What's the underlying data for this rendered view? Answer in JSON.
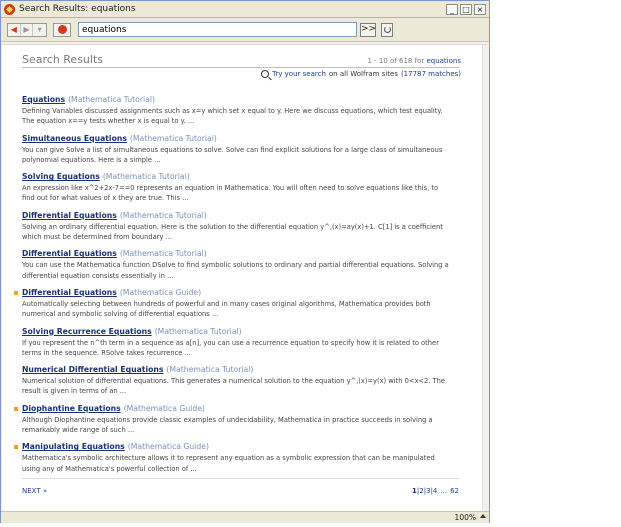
{
  "window": {
    "title": "Search Results: equations"
  },
  "toolbar": {
    "search_value": "equations",
    "go_label": ">>"
  },
  "header": {
    "title": "Search Results",
    "count_prefix": "1 - 10 of 618 for",
    "count_query": "equations",
    "try_prefix": "Try your search",
    "try_link": "Try your search",
    "try_middle": "on all Wolfram sites",
    "try_matches": "(17787 matches)"
  },
  "results": [
    {
      "title": "Equations",
      "source": "(Mathematica Tutorial)",
      "snippet": "Defining Variables discussed assignments such as x=y which set x equal to y. Here we discuss equations, which test equality. The equation x==y tests whether x is equal to y. ...",
      "marked": false
    },
    {
      "title": "Simultaneous Equations",
      "source": "(Mathematica Tutorial)",
      "snippet": "You can give Solve a list of simultaneous equations to solve. Solve can find explicit solutions for a large class of simultaneous polynomial equations. Here is a simple ...",
      "marked": false
    },
    {
      "title": "Solving Equations",
      "source": "(Mathematica Tutorial)",
      "snippet": "An expression like x^2+2x-7==0 represents an equation in Mathematica. You will often need to solve equations like this, to find out for what values of x they are true. This ...",
      "marked": false
    },
    {
      "title": "Differential Equations",
      "source": "(Mathematica Tutorial)",
      "snippet": "Solving an ordinary differential equation. Here is the solution to the differential equation y^,(x)=ay(x)+1. C[1] is a coefficient which must be determined from boundary ...",
      "marked": false
    },
    {
      "title": "Differential Equations",
      "source": "(Mathematica Tutorial)",
      "snippet": "You can use the Mathematica function DSolve to find symbolic solutions to ordinary and partial differential equations. Solving a differential equation consists essentially in ...",
      "marked": false
    },
    {
      "title": "Differential Equations",
      "source": "(Mathematica Guide)",
      "snippet": "Automatically selecting between hundreds of powerful and in many cases original algorithms, Mathematica provides both numerical and symbolic solving of differential equations ...",
      "marked": true
    },
    {
      "title": "Solving Recurrence Equations",
      "source": "(Mathematica Tutorial)",
      "snippet": "If you represent the n^th term in a sequence as a[n], you can use a recurrence equation to specify how it is related to other terms in the sequence. RSolve takes recurrence ...",
      "marked": false
    },
    {
      "title": "Numerical Differential Equations",
      "source": "(Mathematica Tutorial)",
      "snippet": "Numerical solution of differential equations. This generates a numerical solution to the equation y^,(x)=y(x) with 0<x<2. The result is given in terms of an ...",
      "marked": false
    },
    {
      "title": "Diophantine Equations",
      "source": "(Mathematica Guide)",
      "snippet": "Although Diophantine equations provide classic examples of undecidability, Mathematica in practice succeeds in solving a remarkably wide range of such ...",
      "marked": true
    },
    {
      "title": "Manipulating Equations",
      "source": "(Mathematica Guide)",
      "snippet": "Mathematica's symbolic architecture allows it to represent any equation as a symbolic expression that can be manipulated using any of Mathematica's powerful collection of ...",
      "marked": true
    }
  ],
  "footer": {
    "next_label": "NEXT »",
    "pages": [
      "1",
      "2",
      "3",
      "4",
      "62"
    ],
    "ellipsis": "...",
    "sep": "|"
  },
  "status": {
    "zoom": "100%"
  }
}
